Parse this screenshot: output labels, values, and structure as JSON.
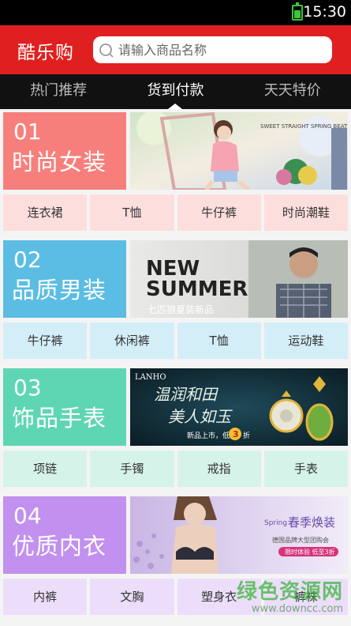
{
  "status_bar": {
    "time": "15:30",
    "battery_icon": "battery-charging-icon"
  },
  "header": {
    "title": "酷乐购",
    "search": {
      "placeholder": "请输入商品名称",
      "value": "",
      "icon": "search-icon"
    }
  },
  "tabs": [
    {
      "label": "热门推荐",
      "active": false
    },
    {
      "label": "货到付款",
      "active": true
    },
    {
      "label": "天天特价",
      "active": false
    }
  ],
  "sections": [
    {
      "number": "01",
      "name": "时尚女装",
      "color": "#f77f7b",
      "subcat_bg": "#fcdedd",
      "banner": {
        "text": "SWEET STRAIGHT SPRING BEAT 春の节拍"
      },
      "subcategories": [
        "连衣裙",
        "T恤",
        "牛仔裤",
        "时尚潮鞋"
      ]
    },
    {
      "number": "02",
      "name": "品质男装",
      "color": "#5bbde3",
      "subcat_bg": "#d4eef8",
      "banner": {
        "headline_1": "NEW",
        "headline_2": "SUMMER",
        "caption": "七匹狼夏装新品"
      },
      "subcategories": [
        "牛仔裤",
        "休闲裤",
        "T恤",
        "运动鞋"
      ]
    },
    {
      "number": "03",
      "name": "饰品手表",
      "color": "#5fd6b3",
      "subcat_bg": "#d6f3ea",
      "banner": {
        "brand": "LANHO",
        "line_1": "温润和田",
        "line_2": "美人如玉",
        "caption": "新品上市，低至",
        "discount": "3",
        "discount_unit": "折"
      },
      "subcategories": [
        "项链",
        "手镯",
        "戒指",
        "手表"
      ]
    },
    {
      "number": "04",
      "name": "优质内衣",
      "color": "#c290ee",
      "subcat_bg": "#ecdefa",
      "banner": {
        "brand": "Spring",
        "line_1": "春季焕装",
        "line_2": "德国品牌大型团购会",
        "caption": "限时体验 低至3折"
      },
      "subcategories": [
        "内裤",
        "文胸",
        "塑身衣",
        "裤袜"
      ]
    }
  ],
  "watermark": {
    "main": "绿色资源网",
    "url": "www.downcc.com"
  }
}
